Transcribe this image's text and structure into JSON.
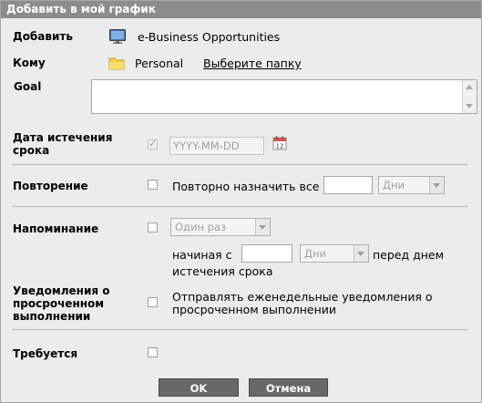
{
  "dialog": {
    "title": "Добавить в мой график"
  },
  "add": {
    "label": "Добавить",
    "item": "e-Business Opportunities",
    "icon": "monitor-icon"
  },
  "to": {
    "label": "Кому",
    "folder": "Personal",
    "choose_link": "Выберите папку",
    "icon": "folder-icon"
  },
  "goal": {
    "label": "Goal",
    "value": ""
  },
  "expiry": {
    "label_line1": "Дата истечения",
    "label_line2": "срока",
    "checked": true,
    "disabled": true,
    "date_placeholder": "YYYY-MM-DD",
    "icon": "calendar-icon"
  },
  "repeat": {
    "label": "Повторение",
    "checked": false,
    "text": "Повторно назначить все",
    "count_value": "",
    "unit_selected": "Дни"
  },
  "reminder": {
    "label": "Напоминание",
    "checked": false,
    "frequency_selected": "Один раз",
    "start_prefix": "начиная с",
    "start_value": "",
    "unit_selected": "Дни",
    "suffix_line1": "перед днем",
    "suffix_line2": "истечения срока"
  },
  "overdue": {
    "label_line1": "Уведомления о",
    "label_line2": "просроченном",
    "label_line3": "выполнении",
    "checked": false,
    "text_line1": "Отправлять еженедельные уведомления о",
    "text_line2": "просроченном выполнении"
  },
  "required": {
    "label": "Требуется",
    "checked": false
  },
  "buttons": {
    "ok": "OK",
    "cancel": "Отмена"
  }
}
